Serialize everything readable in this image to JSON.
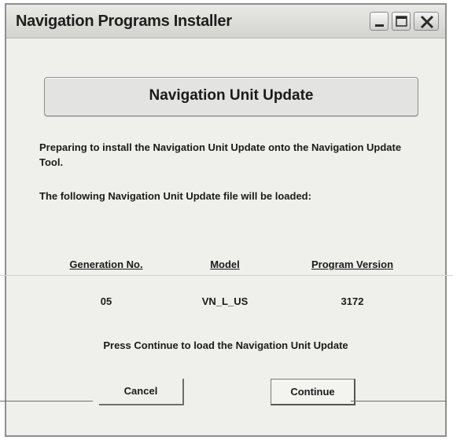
{
  "window": {
    "title": "Navigation Programs Installer",
    "controls": [
      "minimize-icon",
      "maximize-icon",
      "close-icon"
    ]
  },
  "header": {
    "title": "Navigation Unit Update"
  },
  "body": {
    "paragraph1": "Preparing to install the Navigation Unit Update onto the Navigation Update Tool.",
    "paragraph2": "The following Navigation Unit Update file will be loaded:"
  },
  "table": {
    "columns": [
      "Generation No.",
      "Model",
      "Program Version"
    ],
    "rows": [
      [
        "05",
        "VN_L_US",
        "3172"
      ]
    ]
  },
  "prompt": "Press Continue to load the Navigation Unit Update",
  "buttons": {
    "cancel": "Cancel",
    "continue": "Continue"
  }
}
